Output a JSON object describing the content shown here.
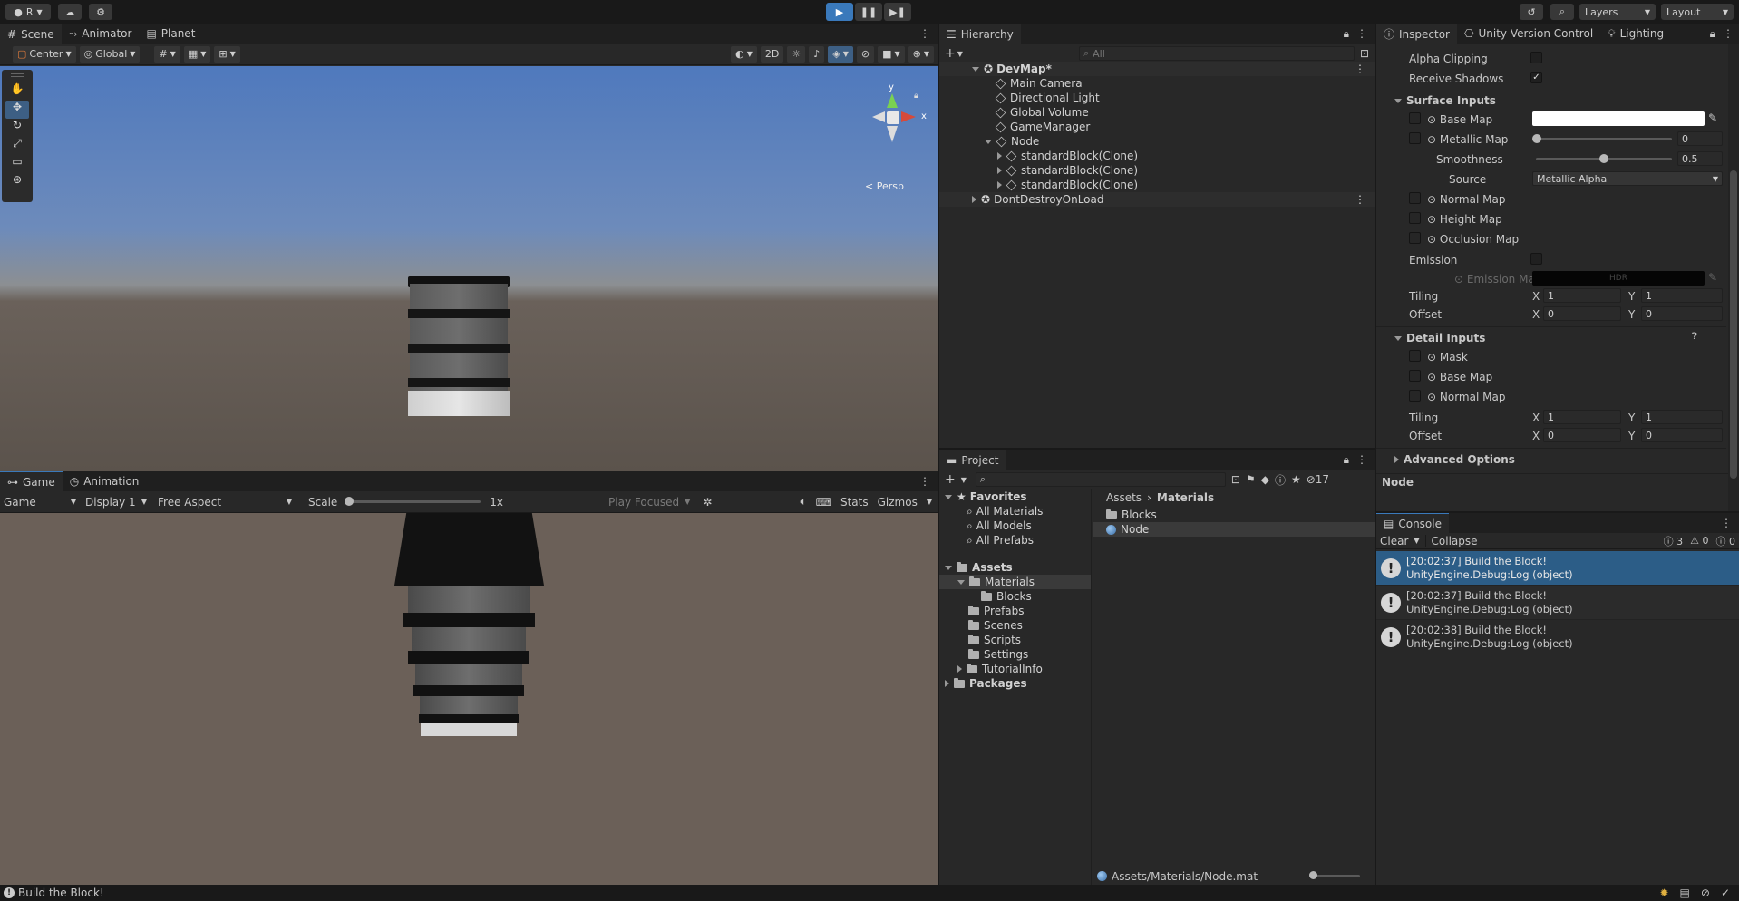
{
  "topbar": {
    "account_label": "R",
    "layers_label": "Layers",
    "layout_label": "Layout"
  },
  "scene_tabs": [
    {
      "label": "Scene"
    },
    {
      "label": "Animator"
    },
    {
      "label": "Planet"
    }
  ],
  "scene_toolbar": {
    "pivot": "Center",
    "space": "Global",
    "mode_2d": "2D"
  },
  "gizmo": {
    "y": "y",
    "x": "x",
    "persp": "Persp"
  },
  "game_tabs": [
    {
      "label": "Game"
    },
    {
      "label": "Animation"
    }
  ],
  "game_toolbar": {
    "view": "Game",
    "display": "Display 1",
    "aspect": "Free Aspect",
    "scale_label": "Scale",
    "scale_value": "1x",
    "play_focused": "Play Focused",
    "stats": "Stats",
    "gizmos": "Gizmos"
  },
  "hierarchy": {
    "title": "Hierarchy",
    "search_placeholder": "All",
    "items": [
      {
        "label": "DevMap*"
      },
      {
        "label": "Main Camera"
      },
      {
        "label": "Directional Light"
      },
      {
        "label": "Global Volume"
      },
      {
        "label": "GameManager"
      },
      {
        "label": "Node"
      },
      {
        "label": "standardBlock(Clone)"
      },
      {
        "label": "standardBlock(Clone)"
      },
      {
        "label": "standardBlock(Clone)"
      },
      {
        "label": "DontDestroyOnLoad"
      }
    ]
  },
  "project": {
    "title": "Project",
    "hidden_count": "17",
    "favorites": {
      "label": "Favorites",
      "items": [
        "All Materials",
        "All Models",
        "All Prefabs"
      ]
    },
    "assets": {
      "label": "Assets",
      "items": [
        "Materials",
        "Blocks",
        "Prefabs",
        "Scenes",
        "Scripts",
        "Settings",
        "TutorialInfo"
      ]
    },
    "packages": "Packages",
    "breadcrumb": [
      "Assets",
      "Materials"
    ],
    "content": [
      "Blocks",
      "Node"
    ],
    "footer_path": "Assets/Materials/Node.mat"
  },
  "inspector_tabs": [
    {
      "label": "Inspector"
    },
    {
      "label": "Unity Version Control"
    },
    {
      "label": "Lighting"
    }
  ],
  "inspector": {
    "alpha_clipping": "Alpha Clipping",
    "receive_shadows": "Receive Shadows",
    "surface_inputs": "Surface Inputs",
    "base_map": "Base Map",
    "metallic_map": "Metallic Map",
    "metallic_value": "0",
    "smoothness": "Smoothness",
    "smoothness_value": "0.5",
    "source": "Source",
    "source_value": "Metallic Alpha",
    "normal_map": "Normal Map",
    "height_map": "Height Map",
    "occlusion_map": "Occlusion Map",
    "emission": "Emission",
    "emission_map": "Emission Map",
    "hdr": "HDR",
    "tiling": "Tiling",
    "offset": "Offset",
    "x": "X",
    "y": "Y",
    "tiling_x": "1",
    "tiling_y": "1",
    "offset_x": "0",
    "offset_y": "0",
    "detail_inputs": "Detail Inputs",
    "mask": "Mask",
    "detail_base_map": "Base Map",
    "detail_normal_map": "Normal Map",
    "d_tiling_x": "1",
    "d_tiling_y": "1",
    "d_offset_x": "0",
    "d_offset_y": "0",
    "advanced_options": "Advanced Options",
    "preview_name": "Node"
  },
  "console": {
    "title": "Console",
    "clear": "Clear",
    "collapse": "Collapse",
    "log_count": "3",
    "warn_count": "0",
    "error_count": "0",
    "entries": [
      {
        "line1": "[20:02:37] Build the Block!",
        "line2": "UnityEngine.Debug:Log (object)"
      },
      {
        "line1": "[20:02:37] Build the Block!",
        "line2": "UnityEngine.Debug:Log (object)"
      },
      {
        "line1": "[20:02:38] Build the Block!",
        "line2": "UnityEngine.Debug:Log (object)"
      }
    ]
  },
  "statusbar": {
    "message": "Build the Block!"
  },
  "colors": {
    "accent": "#3a79bb",
    "selection": "#2c5d87",
    "bg": "#282828",
    "dark": "#191919"
  }
}
